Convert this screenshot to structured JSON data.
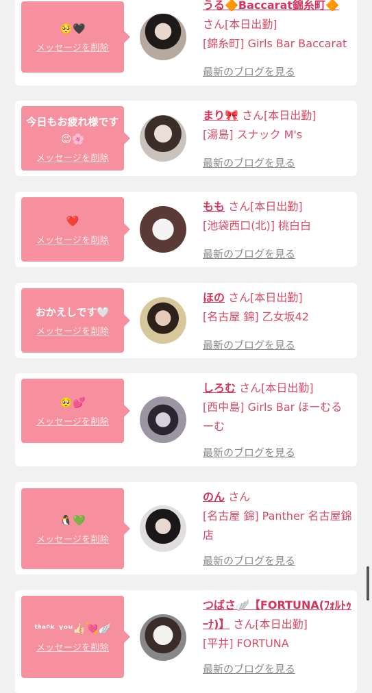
{
  "cards": [
    {
      "message": "🥺🖤",
      "delete_label": "メッセージを削除",
      "name": "うる🔶Baccarat錦糸町🔶",
      "suffix": "さん[本日出勤]",
      "shop": "[錦糸町] Girls Bar Baccarat",
      "blog_label": "最新のブログを見る"
    },
    {
      "message": "今日もお疲れ様です😉🌸",
      "delete_label": "メッセージを削除",
      "name": "まり🎀",
      "suffix": "さん[本日出勤]",
      "shop": "[湯島] スナック M's",
      "blog_label": "最新のブログを見る"
    },
    {
      "message": "❤️",
      "delete_label": "メッセージを削除",
      "name": "もも",
      "suffix": "さん[本日出勤]",
      "shop": "[池袋西口(北)] 桃白白",
      "blog_label": "最新のブログを見る"
    },
    {
      "message": "おかえしです🤍",
      "delete_label": "メッセージを削除",
      "name": "ほの",
      "suffix": "さん[本日出勤]",
      "shop": "[名古屋 錦] 乙女坂42",
      "blog_label": "最新のブログを見る"
    },
    {
      "message": "🥺💕",
      "delete_label": "メッセージを削除",
      "name": "しろむ",
      "suffix": "さん[本日出勤]",
      "shop": "[西中島] Girls Bar ほーむるーむ",
      "blog_label": "最新のブログを見る"
    },
    {
      "message": "🐧💚",
      "delete_label": "メッセージを削除",
      "name": "のん",
      "suffix": "さん",
      "shop": "[名古屋 錦] Panther 名古屋錦店",
      "blog_label": "最新のブログを見る"
    },
    {
      "message": "ᵗᑋᵃᐢᵏ ᵞᵒᵘ👍🏻💘🪽",
      "delete_label": "メッセージを削除",
      "name": "つばさ🪽【FORTUNA(ﾌｫﾙﾄｩｰﾅ)】",
      "suffix": "さん[本日出勤]",
      "shop": "[平井] FORTUNA",
      "blog_label": "最新のブログを見る"
    }
  ]
}
